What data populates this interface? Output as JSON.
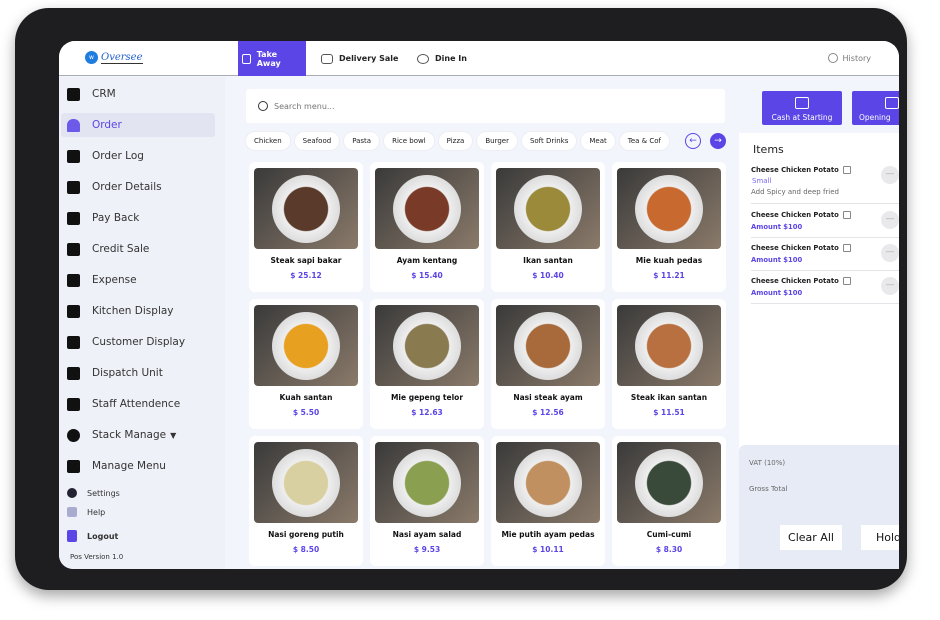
{
  "brand": {
    "name": "Oversee",
    "logo_letter": "w"
  },
  "tabs": [
    {
      "label": "Take Away",
      "icon": "bag-icon"
    },
    {
      "label": "Delivery Sale",
      "icon": "scooter-icon"
    },
    {
      "label": "Dine In",
      "icon": "plate-cutlery-icon"
    }
  ],
  "history_label": "History",
  "sidebar": {
    "items": [
      {
        "label": "CRM"
      },
      {
        "label": "Order"
      },
      {
        "label": "Order Log"
      },
      {
        "label": "Order Details"
      },
      {
        "label": "Pay Back"
      },
      {
        "label": "Credit Sale"
      },
      {
        "label": "Expense"
      },
      {
        "label": "Kitchen Display"
      },
      {
        "label": "Customer Display"
      },
      {
        "label": "Dispatch Unit"
      },
      {
        "label": "Staff Attendence"
      },
      {
        "label": "Stack Manage",
        "caret": "▼"
      },
      {
        "label": "Manage Menu"
      }
    ],
    "settings": "Settings",
    "help": "Help",
    "logout": "Logout",
    "version": "Pos Version 1.0"
  },
  "search": {
    "placeholder": "Search menu..."
  },
  "categories": [
    "Chicken",
    "Seafood",
    "Pasta",
    "Rice bowl",
    "Pizza",
    "Burger",
    "Soft Drinks",
    "Meat",
    "Tea & Cof"
  ],
  "products": [
    {
      "name": "Steak sapi bakar",
      "price": "$ 25.12",
      "color": "#5a3a2a"
    },
    {
      "name": "Ayam kentang",
      "price": "$ 15.40",
      "color": "#7a3a28"
    },
    {
      "name": "Ikan santan",
      "price": "$ 10.40",
      "color": "#9a8a3a"
    },
    {
      "name": "Mie kuah pedas",
      "price": "$ 11.21",
      "color": "#c86a30"
    },
    {
      "name": "Kuah santan",
      "price": "$ 5.50",
      "color": "#e8a020"
    },
    {
      "name": "Mie gepeng telor",
      "price": "$ 12.63",
      "color": "#8a7a50"
    },
    {
      "name": "Nasi steak ayam",
      "price": "$ 12.56",
      "color": "#a86a3a"
    },
    {
      "name": "Steak ikan santan",
      "price": "$ 11.51",
      "color": "#b87040"
    },
    {
      "name": "Nasi goreng putih",
      "price": "$ 8.50",
      "color": "#d8d0a0"
    },
    {
      "name": "Nasi ayam salad",
      "price": "$ 9.53",
      "color": "#8aa050"
    },
    {
      "name": "Mie putih ayam pedas",
      "price": "$ 10.11",
      "color": "#c09060"
    },
    {
      "name": "Cumi-cumi",
      "price": "$ 8.30",
      "color": "#3a4a3a"
    }
  ],
  "actions": {
    "cash": "Cash at Starting",
    "opening": "Opening"
  },
  "order": {
    "title": "Items",
    "items": [
      {
        "name": "Cheese Chicken Potato",
        "size": "Small",
        "note": "Add Spicy and deep fried"
      },
      {
        "name": "Cheese Chicken Potato",
        "amount": "Amount $100"
      },
      {
        "name": "Cheese Chicken Potato",
        "amount": "Amount $100"
      },
      {
        "name": "Cheese Chicken Potato",
        "amount": "Amount $100"
      }
    ]
  },
  "totals": {
    "vat": "VAT (10%)",
    "gross": "Gross Total"
  },
  "buttons": {
    "clear": "Clear All",
    "hold": "Hold"
  },
  "colors": {
    "accent": "#5b45e6"
  }
}
